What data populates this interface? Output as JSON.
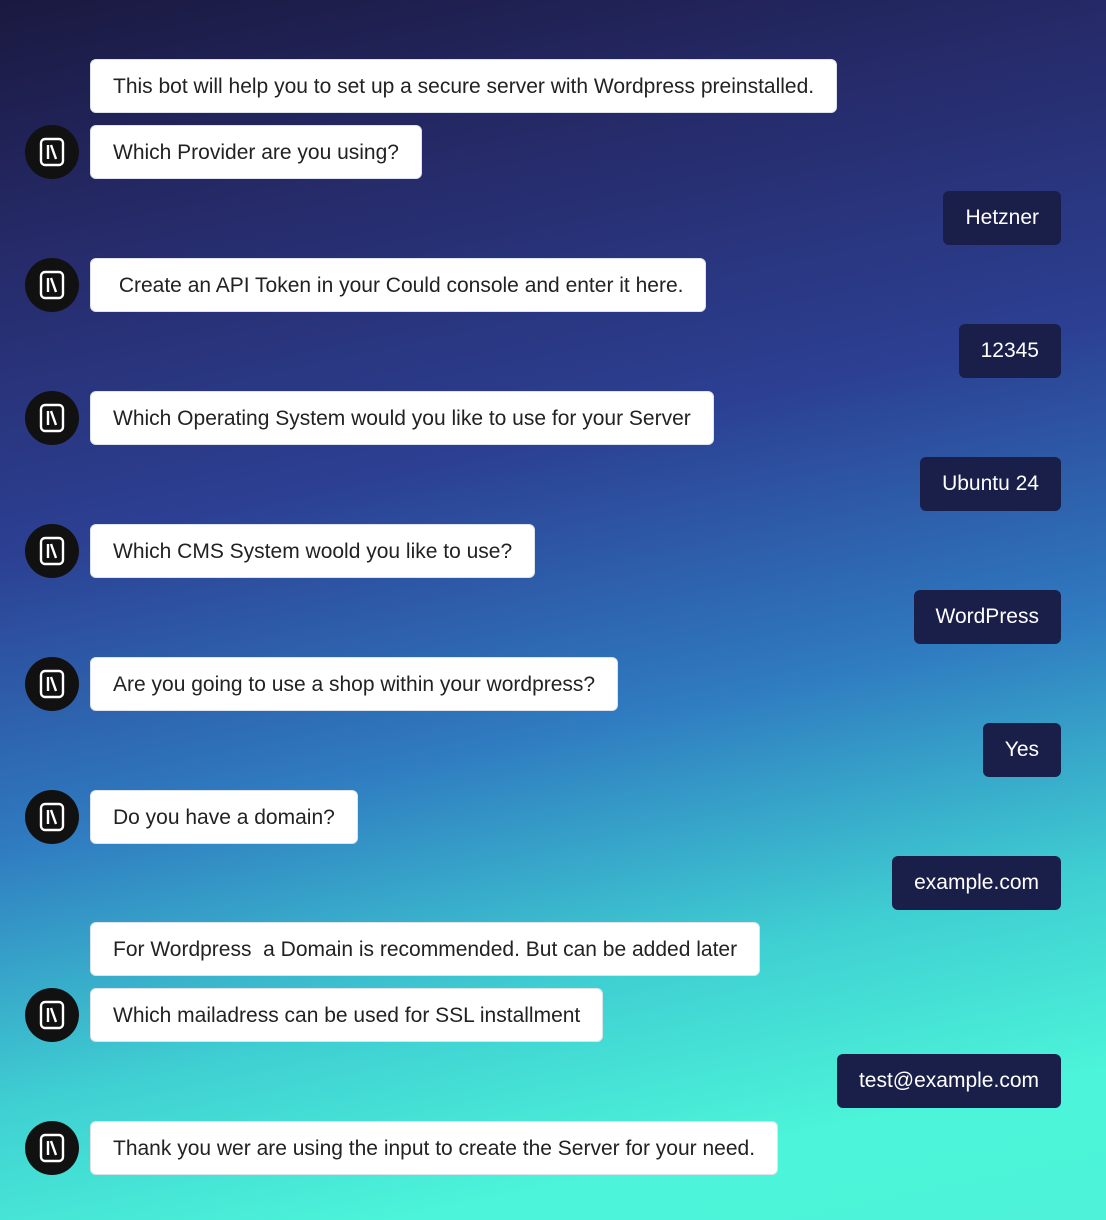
{
  "chat": {
    "bot_icon": "terminal-icon",
    "colors": {
      "user_bubble": "#1a1f4a",
      "bot_bubble": "#ffffff",
      "avatar": "#111111"
    },
    "messages": [
      {
        "from": "bot",
        "text": "This bot will help you to set up a secure server with Wordpress preinstalled."
      },
      {
        "from": "bot",
        "text": "Which Provider are you using?"
      },
      {
        "from": "user",
        "text": "Hetzner"
      },
      {
        "from": "bot",
        "text": " Create an API Token in your Could console and enter it here."
      },
      {
        "from": "user",
        "text": "12345"
      },
      {
        "from": "bot",
        "text": "Which Operating System would you like to use for your Server"
      },
      {
        "from": "user",
        "text": "Ubuntu 24"
      },
      {
        "from": "bot",
        "text": "Which CMS System woold you like to use?"
      },
      {
        "from": "user",
        "text": "WordPress"
      },
      {
        "from": "bot",
        "text": "Are you going to use a shop within your wordpress?"
      },
      {
        "from": "user",
        "text": "Yes"
      },
      {
        "from": "bot",
        "text": "Do you have a domain?"
      },
      {
        "from": "user",
        "text": "example.com"
      },
      {
        "from": "bot",
        "text": "For Wordpress  a Domain is recommended. But can be added later"
      },
      {
        "from": "bot",
        "text": "Which mailadress can be used for SSL installment"
      },
      {
        "from": "user",
        "text": "test@example.com"
      },
      {
        "from": "bot",
        "text": "Thank you wer are using the input to create the Server for your need."
      }
    ]
  }
}
